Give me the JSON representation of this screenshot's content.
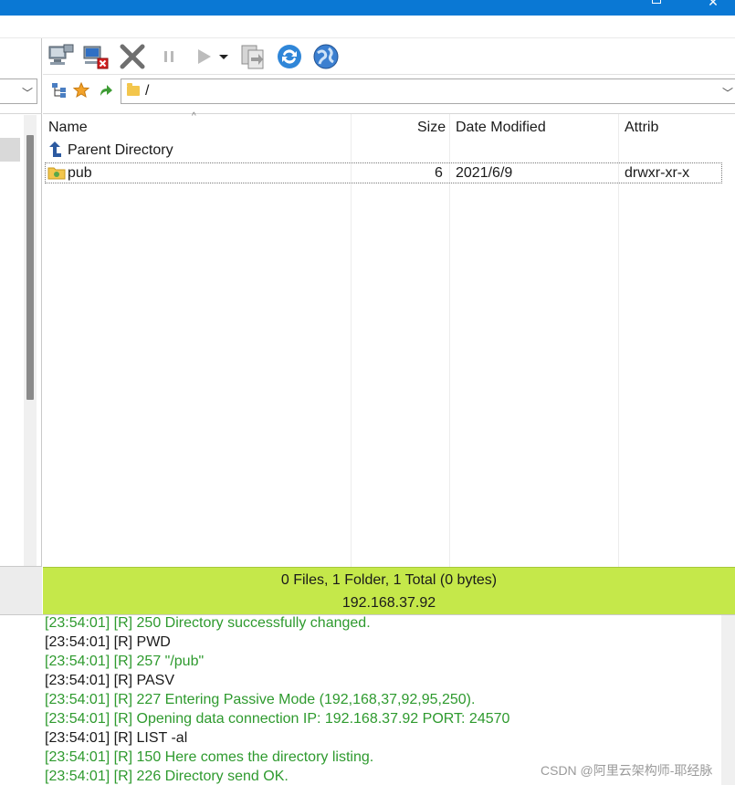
{
  "address": {
    "path": "/"
  },
  "file_list": {
    "columns": [
      "Name",
      "Size",
      "Date Modified",
      "Attrib"
    ],
    "parent_label": "Parent Directory",
    "rows": [
      {
        "name": "pub",
        "size": "6",
        "date": "2021/6/9",
        "attrib": "drwxr-xr-x"
      }
    ]
  },
  "status": {
    "summary": "0 Files, 1 Folder, 1 Total (0 bytes)",
    "host": "192.168.37.92",
    "bg_color": "#c5e84a"
  },
  "log": [
    {
      "time": "[23:54:01]",
      "text": "[R] 250 Directory successfully changed.",
      "color": "green"
    },
    {
      "time": "[23:54:01]",
      "text": "[R] PWD",
      "color": "black"
    },
    {
      "time": "[23:54:01]",
      "text": "[R] 257 \"/pub\"",
      "color": "green"
    },
    {
      "time": "[23:54:01]",
      "text": "[R] PASV",
      "color": "black"
    },
    {
      "time": "[23:54:01]",
      "text": "[R] 227 Entering Passive Mode (192,168,37,92,95,250).",
      "color": "green"
    },
    {
      "time": "[23:54:01]",
      "text": "[R] Opening data connection IP: 192.168.37.92 PORT: 24570",
      "color": "green"
    },
    {
      "time": "[23:54:01]",
      "text": "[R] LIST -al",
      "color": "black"
    },
    {
      "time": "[23:54:01]",
      "text": "[R] 150 Here comes the directory listing.",
      "color": "green"
    },
    {
      "time": "[23:54:01]",
      "text": "[R] 226 Directory send OK.",
      "color": "green"
    }
  ],
  "watermark": "CSDN @阿里云架构师-耶经脉",
  "toolbar_icons": [
    "connect-icon",
    "disconnect-icon",
    "abort-icon",
    "pause-icon",
    "play-icon",
    "queue-dropdown-icon",
    "transfer-icon",
    "refresh-icon",
    "globe-icon"
  ],
  "colors": {
    "titlebar": "#0a78d4",
    "log_green": "#2e9a2e"
  }
}
